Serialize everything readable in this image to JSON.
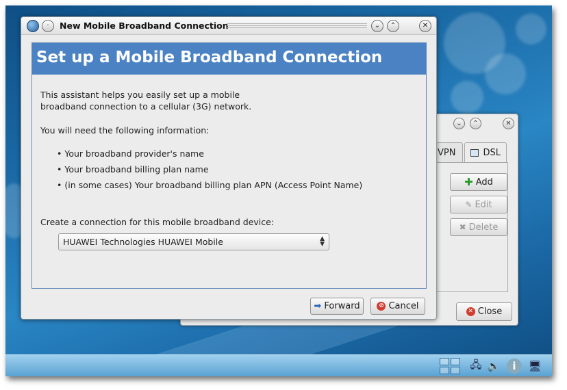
{
  "dialog": {
    "title": "New Mobile Broadband Connection",
    "banner": "Set up a Mobile Broadband Connection",
    "intro_line1": "This assistant helps you easily set up a mobile",
    "intro_line2": "broadband connection to a cellular (3G) network.",
    "need_info": "You will need the following information:",
    "bullets": [
      "• Your broadband provider's name",
      "• Your broadband billing plan name",
      "• (in some cases) Your broadband billing plan APN (Access Point Name)"
    ],
    "device_label": "Create a connection for this mobile broadband device:",
    "device_selected": "HUAWEI Technologies HUAWEI Mobile",
    "forward_label": "Forward",
    "cancel_label": "Cancel"
  },
  "background_window": {
    "tabs": [
      "VPN",
      "DSL"
    ],
    "add_label": "Add",
    "edit_label": "Edit",
    "delete_label": "Delete",
    "close_label": "Close"
  },
  "colors": {
    "banner": "#4a82c4",
    "desktop": "#1a6aa6",
    "panel": "#7fbbe2"
  },
  "icons": {
    "app": "network-globe-icon",
    "forward": "forward-arrow-icon",
    "cancel": "cancel-icon",
    "add": "plus-icon",
    "edit": "pencil-icon",
    "delete": "x-icon",
    "close": "close-icon"
  }
}
